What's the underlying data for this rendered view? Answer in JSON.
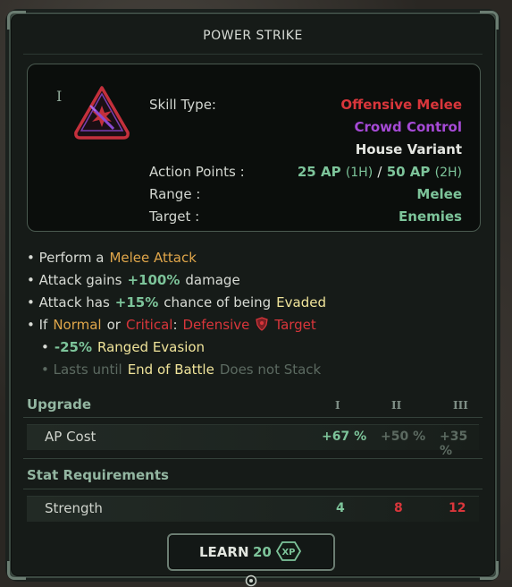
{
  "title": "POWER STRIKE",
  "tier_marker": "I",
  "info": {
    "skill_type_label": "Skill Type:",
    "skill_type_1": "Offensive Melee",
    "skill_type_2": "Crowd Control",
    "skill_type_3": "House Variant",
    "ap_label": "Action Points :",
    "ap_value_1": "25 AP",
    "ap_tag_1": "(1H)",
    "ap_sep": "/",
    "ap_value_2": "50 AP",
    "ap_tag_2": "(2H)",
    "range_label": "Range :",
    "range_value": "Melee",
    "target_label": "Target :",
    "target_value": "Enemies"
  },
  "description": {
    "l1_pre": "• Perform a",
    "l1_hl": "Melee Attack",
    "l2_pre": "• Attack gains",
    "l2_hl": "+100%",
    "l2_post": "damage",
    "l3_pre": "• Attack has",
    "l3_hl": "+15%",
    "l3_mid": "chance of being",
    "l3_hl2": "Evaded",
    "l4_pre": "• If",
    "l4_a": "Normal",
    "l4_or": "or",
    "l4_b": "Critical",
    "l4_colon": ":",
    "l4_c": "Defensive",
    "l4_d": "Target",
    "l5_pre": "•",
    "l5_hl": "-25%",
    "l5_post": "Ranged Evasion",
    "l6_pre": "• Lasts until",
    "l6_hl": "End of Battle",
    "l6_post": "Does not Stack"
  },
  "upgrade": {
    "header": "Upgrade",
    "tiers": [
      "I",
      "II",
      "III"
    ],
    "row_label": "AP Cost",
    "values": [
      "+67 %",
      "+50 %",
      "+35 %"
    ]
  },
  "requirements": {
    "header": "Stat Requirements",
    "row_label": "Strength",
    "values": [
      "4",
      "8",
      "12"
    ]
  },
  "learn": {
    "label": "LEARN",
    "cost": "20",
    "unit": "XP"
  },
  "colors": {
    "offensive": "#d9363b",
    "crowd_control": "#a64ad6",
    "positive": "#7dc49a",
    "highlight": "#f0e49a",
    "melee": "#e0a64a"
  }
}
